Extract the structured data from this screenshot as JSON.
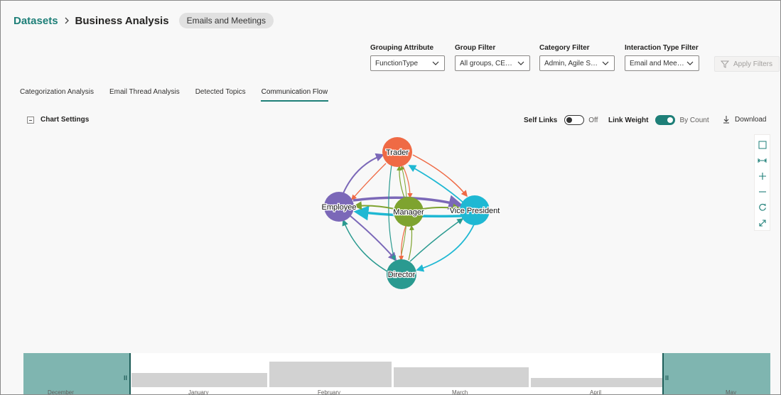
{
  "header": {
    "breadcrumb_root": "Datasets",
    "breadcrumb_current": "Business Analysis",
    "dataset_pill": "Emails and Meetings"
  },
  "filters": [
    {
      "label": "Grouping Attribute",
      "value": "FunctionType"
    },
    {
      "label": "Group Filter",
      "value": "All groups, CEO, ..."
    },
    {
      "label": "Category Filter",
      "value": "Admin, Agile Syn..."
    },
    {
      "label": "Interaction Type Filter",
      "value": "Email and Meeti..."
    }
  ],
  "apply_filters": "Apply Filters",
  "tabs": [
    {
      "label": "Categorization Analysis",
      "active": false
    },
    {
      "label": "Email Thread Analysis",
      "active": false
    },
    {
      "label": "Detected Topics",
      "active": false
    },
    {
      "label": "Communication Flow",
      "active": true
    }
  ],
  "chart_settings": {
    "label": "Chart Settings",
    "self_links_label": "Self Links",
    "self_links_state": "Off",
    "link_weight_label": "Link Weight",
    "link_weight_state": "By Count",
    "download_label": "Download"
  },
  "toolbar_icons": [
    "select-box-icon",
    "fit-width-icon",
    "zoom-in-icon",
    "zoom-out-icon",
    "reset-icon",
    "expand-icon"
  ],
  "graph": {
    "nodes": [
      {
        "id": "trader",
        "label": "Trader",
        "color": "#ef6a45"
      },
      {
        "id": "employee",
        "label": "Employee",
        "color": "#7b68b8"
      },
      {
        "id": "manager",
        "label": "Manager",
        "color": "#7ea32f"
      },
      {
        "id": "vp",
        "label": "Vice President",
        "color": "#1fb8d3"
      },
      {
        "id": "director",
        "label": "Director",
        "color": "#2a9a90"
      }
    ]
  },
  "timeline": {
    "months": [
      "December",
      "January",
      "February",
      "March",
      "April",
      "May"
    ],
    "activity": [
      0,
      0.55,
      1.0,
      0.78,
      0.35,
      0
    ]
  },
  "colors": {
    "accent": "#1e7f78",
    "timeline_selection": "#7fb5b0"
  }
}
